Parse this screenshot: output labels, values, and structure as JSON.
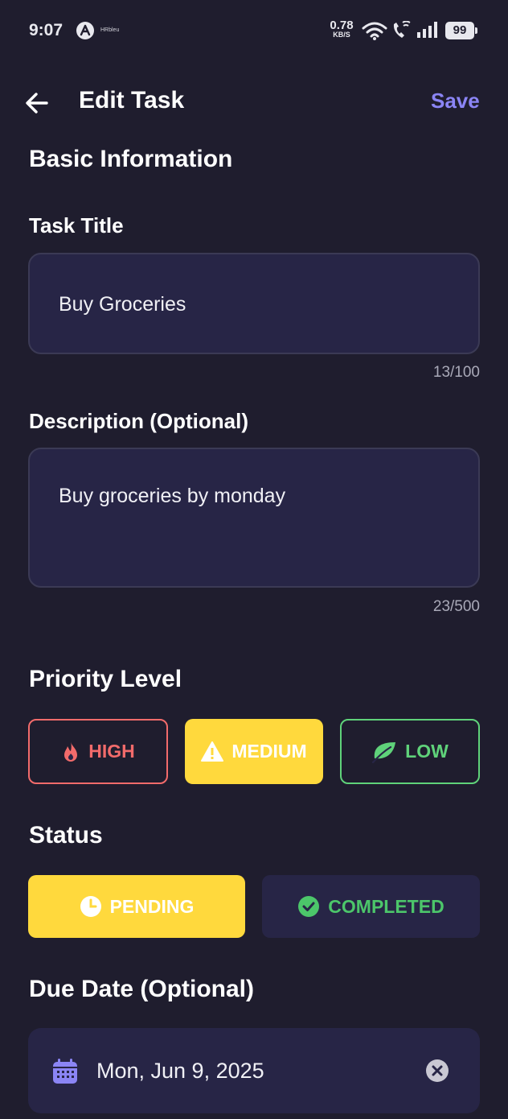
{
  "status_bar": {
    "time": "9:07",
    "mini_label": "HRbleu",
    "net_speed_value": "0.78",
    "net_speed_unit": "KB/S",
    "battery": "99"
  },
  "header": {
    "title": "Edit Task",
    "save_label": "Save"
  },
  "basic_info": {
    "heading": "Basic Information",
    "title_label": "Task Title",
    "title_value": "Buy Groceries",
    "title_counter": "13/100",
    "description_label": "Description (Optional)",
    "description_value": "Buy groceries by monday",
    "description_counter": "23/500"
  },
  "priority": {
    "heading": "Priority Level",
    "options": [
      {
        "label": "HIGH",
        "icon": "flame-icon",
        "color": "#f26b6b"
      },
      {
        "label": "MEDIUM",
        "icon": "warning-icon",
        "color": "#ffd93d",
        "selected": true
      },
      {
        "label": "LOW",
        "icon": "leaf-icon",
        "color": "#5fd27a"
      }
    ]
  },
  "status": {
    "heading": "Status",
    "options": [
      {
        "label": "PENDING",
        "icon": "clock-icon",
        "selected": true
      },
      {
        "label": "COMPLETED",
        "icon": "check-circle-icon",
        "color": "#4cc66a"
      }
    ]
  },
  "due_date": {
    "heading": "Due Date (Optional)",
    "value": "Mon, Jun 9, 2025"
  },
  "colors": {
    "background": "#1f1d2e",
    "surface": "#272546",
    "accent": "#8b85f5",
    "selected_chip": "#ffd93d"
  }
}
